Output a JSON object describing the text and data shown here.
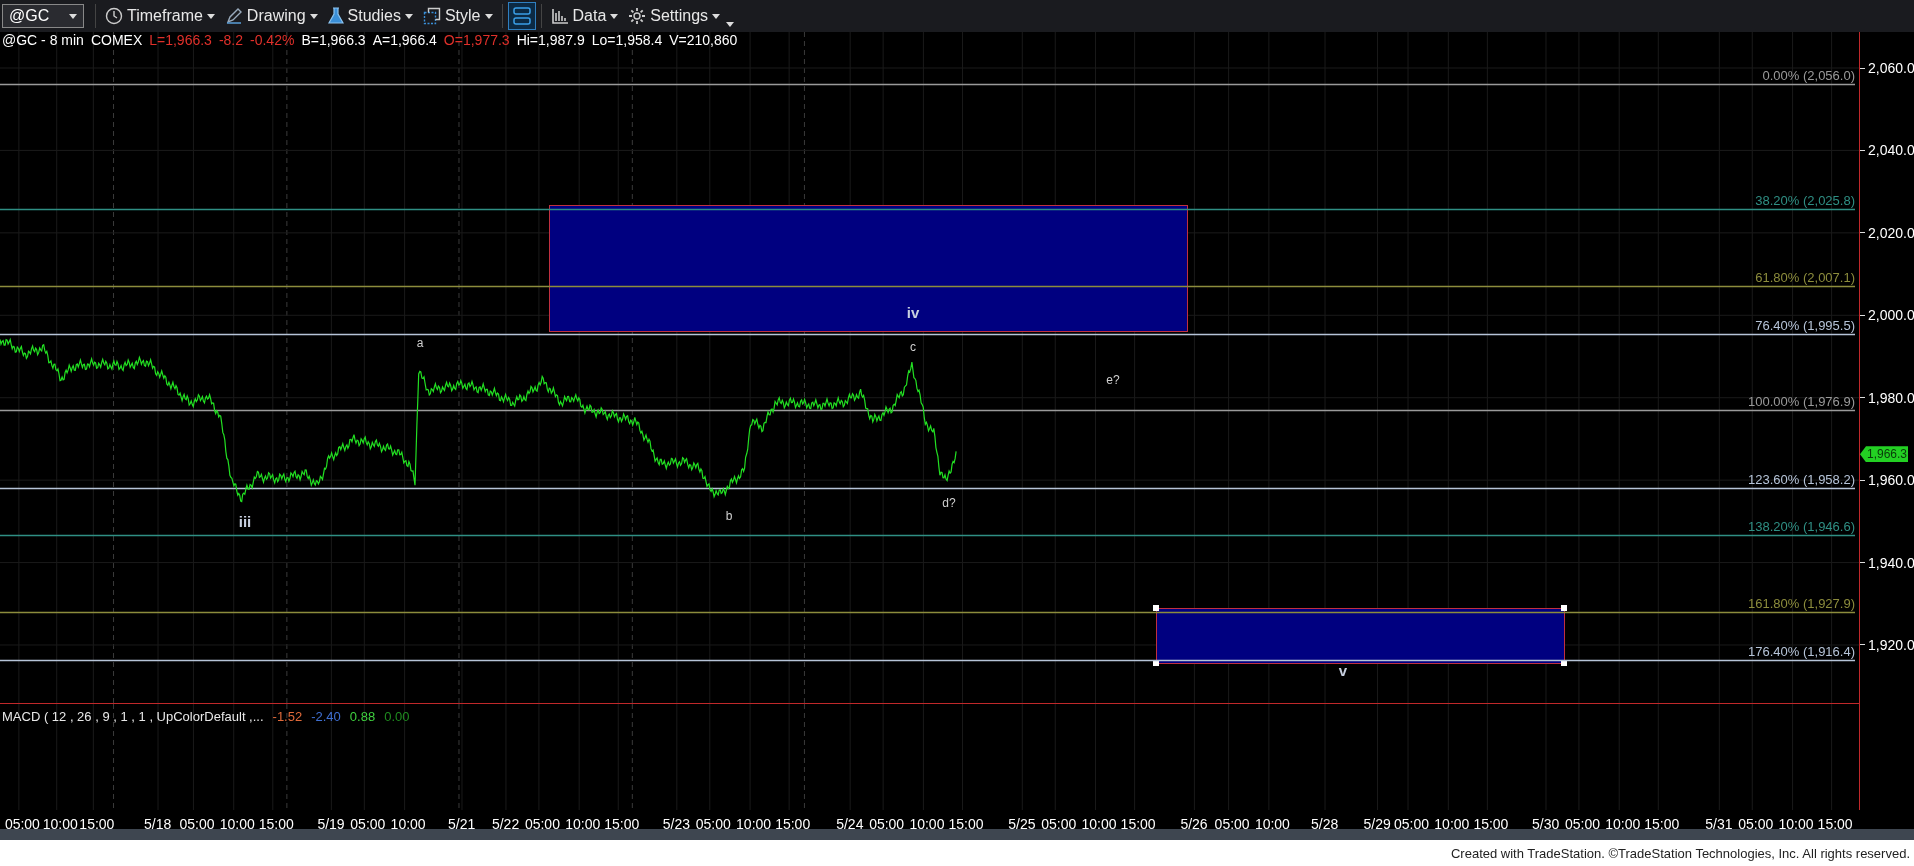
{
  "toolbar": {
    "symbol": "@GC",
    "items": [
      {
        "kind": "menu",
        "label": "Timeframe"
      },
      {
        "kind": "menu",
        "label": "Drawing"
      },
      {
        "kind": "menu",
        "label": "Studies"
      },
      {
        "kind": "menu",
        "label": "Style"
      },
      {
        "kind": "toggle",
        "on": true
      },
      {
        "kind": "menu",
        "label": "Data"
      },
      {
        "kind": "menu",
        "label": "Settings"
      }
    ]
  },
  "quote_line": [
    {
      "text": "@GC - 8 min",
      "color": "#ffffff"
    },
    {
      "text": "COMEX",
      "color": "#ffffff"
    },
    {
      "text": "L=1,966.3",
      "color": "#e0302a"
    },
    {
      "text": "-8.2",
      "color": "#e0302a"
    },
    {
      "text": "-0.42%",
      "color": "#e0302a"
    },
    {
      "text": "B=1,966.3",
      "color": "#ffffff"
    },
    {
      "text": "A=1,966.4",
      "color": "#ffffff"
    },
    {
      "text": "O=1,977.3",
      "color": "#e0302a"
    },
    {
      "text": "Hi=1,987.9",
      "color": "#ffffff"
    },
    {
      "text": "Lo=1,958.4",
      "color": "#ffffff"
    },
    {
      "text": "V=210,860",
      "color": "#ffffff"
    }
  ],
  "fib_levels": [
    {
      "label": "0.00% (2,056.0)",
      "color": "#9a9a9a"
    },
    {
      "label": "38.20% (2,025.8)",
      "color": "#2f8f84"
    },
    {
      "label": "61.80% (2,007.1)",
      "color": "#8c8c3c"
    },
    {
      "label": "76.40% (1,995.5)",
      "color": "#b6c4d8"
    },
    {
      "label": "100.00% (1,976.9)",
      "color": "#9a9a9a"
    },
    {
      "label": "123.60% (1,958.2)",
      "color": "#b6c4d8"
    },
    {
      "label": "138.20% (1,946.6)",
      "color": "#2f8f84"
    },
    {
      "label": "161.80% (1,927.9)",
      "color": "#8c8c3c"
    },
    {
      "label": "176.40% (1,916.4)",
      "color": "#b6c4d8"
    }
  ],
  "wave_labels": [
    {
      "text": "iii",
      "kind": "major"
    },
    {
      "text": "a",
      "kind": "minor"
    },
    {
      "text": "b",
      "kind": "minor"
    },
    {
      "text": "c",
      "kind": "minor"
    },
    {
      "text": "iv",
      "kind": "major"
    },
    {
      "text": "d?",
      "kind": "minor"
    },
    {
      "text": "e?",
      "kind": "minor"
    },
    {
      "text": "v",
      "kind": "major"
    }
  ],
  "price_axis": {
    "ticks": [
      "2,060.0",
      "2,040.0",
      "2,020.0",
      "2,000.0",
      "1,980.0",
      "1,960.0",
      "1,940.0",
      "1,920.0"
    ],
    "last_price": "1,966.3"
  },
  "macd": {
    "label": "MACD ( 12 , 26 , 9 , 1 , 1 , UpColorDefault ,...",
    "values": [
      {
        "text": "-1.52",
        "color": "#e06a3a"
      },
      {
        "text": "-2.40",
        "color": "#3f6fd0"
      },
      {
        "text": "0.88",
        "color": "#3fd03f"
      },
      {
        "text": "0.00",
        "color": "#1f8a1f"
      }
    ]
  },
  "time_axis": [
    "05:00",
    "10:00",
    "15:00",
    "5/18",
    "05:00",
    "10:00",
    "15:00",
    "5/19",
    "05:00",
    "10:00",
    "5/21",
    "5/22",
    "05:00",
    "10:00",
    "15:00",
    "5/23",
    "05:00",
    "10:00",
    "15:00",
    "5/24",
    "05:00",
    "10:00",
    "15:00",
    "5/25",
    "05:00",
    "10:00",
    "15:00",
    "5/26",
    "05:00",
    "10:00",
    "5/28",
    "5/29",
    "05:00",
    "10:00",
    "15:00",
    "5/30",
    "05:00",
    "10:00",
    "15:00",
    "5/31",
    "05:00",
    "10:00",
    "15:00"
  ],
  "footer": "Created with TradeStation. ©TradeStation Technologies, Inc. All rights reserved."
}
